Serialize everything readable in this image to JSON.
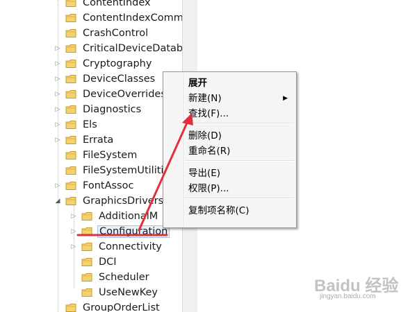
{
  "tree": {
    "items": [
      {
        "label": "ContentIndex",
        "level": 0,
        "expander": "none"
      },
      {
        "label": "ContentIndexComm",
        "level": 0,
        "expander": "none"
      },
      {
        "label": "CrashControl",
        "level": 0,
        "expander": "none"
      },
      {
        "label": "CriticalDeviceDatab",
        "level": 0,
        "expander": "collapsed"
      },
      {
        "label": "Cryptography",
        "level": 0,
        "expander": "collapsed"
      },
      {
        "label": "DeviceClasses",
        "level": 0,
        "expander": "collapsed"
      },
      {
        "label": "DeviceOverrides",
        "level": 0,
        "expander": "collapsed"
      },
      {
        "label": "Diagnostics",
        "level": 0,
        "expander": "collapsed"
      },
      {
        "label": "Els",
        "level": 0,
        "expander": "collapsed"
      },
      {
        "label": "Errata",
        "level": 0,
        "expander": "collapsed"
      },
      {
        "label": "FileSystem",
        "level": 0,
        "expander": "none"
      },
      {
        "label": "FileSystemUtiliti",
        "level": 0,
        "expander": "none"
      },
      {
        "label": "FontAssoc",
        "level": 0,
        "expander": "collapsed"
      },
      {
        "label": "GraphicsDrivers",
        "level": 0,
        "expander": "expanded"
      },
      {
        "label": "AdditionalM",
        "level": 1,
        "expander": "collapsed"
      },
      {
        "label": "Configuration",
        "level": 1,
        "expander": "collapsed",
        "selected": true
      },
      {
        "label": "Connectivity",
        "level": 1,
        "expander": "collapsed"
      },
      {
        "label": "DCI",
        "level": 1,
        "expander": "none"
      },
      {
        "label": "Scheduler",
        "level": 1,
        "expander": "none"
      },
      {
        "label": "UseNewKey",
        "level": 1,
        "expander": "none"
      },
      {
        "label": "GroupOrderList",
        "level": 0,
        "expander": "none"
      }
    ]
  },
  "context_menu": {
    "items": [
      {
        "label": "展开",
        "bold": true
      },
      {
        "label": "新建(N)",
        "submenu": true
      },
      {
        "label": "查找(F)..."
      },
      {
        "separator": true
      },
      {
        "label": "删除(D)"
      },
      {
        "label": "重命名(R)"
      },
      {
        "separator": true
      },
      {
        "label": "导出(E)"
      },
      {
        "label": "权限(P)..."
      },
      {
        "separator": true
      },
      {
        "label": "复制项名称(C)"
      }
    ]
  },
  "icons": {
    "folder": "folder-icon",
    "expander_collapsed": "triangle-right-icon",
    "expander_expanded": "triangle-down-icon",
    "submenu": "chevron-right-icon"
  },
  "colors": {
    "annotation": "#e0303a",
    "folder": "#e8c15a",
    "selection_border": "#9ec5ee",
    "menu_bg": "#f5f5f5"
  },
  "watermark": {
    "main": "Baidu 经验",
    "sub": "jingyan.baidu.com"
  }
}
